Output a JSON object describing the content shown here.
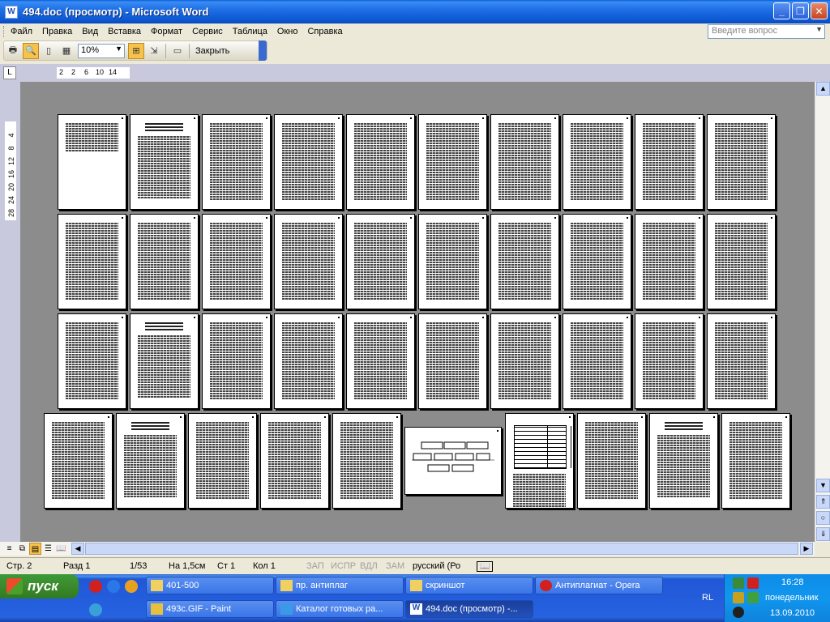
{
  "window": {
    "title": "494.doc (просмотр) - Microsoft Word"
  },
  "menu": {
    "items": [
      "Файл",
      "Правка",
      "Вид",
      "Вставка",
      "Формат",
      "Сервис",
      "Таблица",
      "Окно",
      "Справка"
    ],
    "ask_placeholder": "Введите вопрос"
  },
  "toolbar": {
    "zoom_value": "10%",
    "close_label": "Закрыть"
  },
  "ruler": {
    "h_ticks": [
      "2",
      "2",
      "6",
      "10",
      "14"
    ],
    "v_ticks": [
      "4",
      "8",
      "12",
      "16",
      "20",
      "24",
      "28"
    ]
  },
  "document": {
    "total_pages": 53
  },
  "status": {
    "page": "Стр. 2",
    "section": "Разд 1",
    "page_of": "1/53",
    "at": "На 1,5см",
    "line": "Ст 1",
    "col": "Кол 1",
    "rec": "ЗАП",
    "trk": "ИСПР",
    "ext": "ВДЛ",
    "ovr": "ЗАМ",
    "language": "русский (Ро"
  },
  "taskbar": {
    "start_label": "пуск",
    "tasks_row1": [
      "401-500",
      "пр. антиплаг",
      "скриншот",
      "Антиплагиат - Opera"
    ],
    "tasks_row2": [
      "493c.GIF - Paint",
      "Каталог готовых ра...",
      "494.doc (просмотр) -..."
    ],
    "active_task": "494.doc (просмотр) -...",
    "language_indicator": "RL"
  },
  "clock": {
    "time": "16:28",
    "day": "понедельник",
    "date": "13.09.2010"
  },
  "colors": {
    "titlebar": "#0b56d0",
    "taskbar": "#2663e0",
    "tray": "#1196ee",
    "workspace": "#8c8c8c",
    "start": "#3c8a2c"
  }
}
